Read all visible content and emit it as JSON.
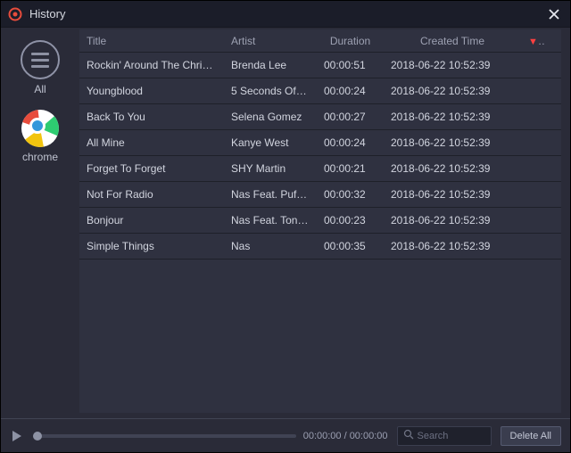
{
  "window": {
    "title": "History"
  },
  "sidebar": {
    "items": [
      {
        "label": "All"
      },
      {
        "label": "chrome"
      }
    ]
  },
  "table": {
    "columns": {
      "title": "Title",
      "artist": "Artist",
      "duration": "Duration",
      "created": "Created Time"
    },
    "rows": [
      {
        "title": "Rockin' Around The Christ…",
        "artist": "Brenda Lee",
        "duration": "00:00:51",
        "created": "2018-06-22 10:52:39"
      },
      {
        "title": "Youngblood",
        "artist": "5 Seconds Of …",
        "duration": "00:00:24",
        "created": "2018-06-22 10:52:39"
      },
      {
        "title": "Back To You",
        "artist": "Selena Gomez",
        "duration": "00:00:27",
        "created": "2018-06-22 10:52:39"
      },
      {
        "title": "All Mine",
        "artist": "Kanye West",
        "duration": "00:00:24",
        "created": "2018-06-22 10:52:39"
      },
      {
        "title": "Forget To Forget",
        "artist": "SHY Martin",
        "duration": "00:00:21",
        "created": "2018-06-22 10:52:39"
      },
      {
        "title": "Not For Radio",
        "artist": "Nas Feat. Puff …",
        "duration": "00:00:32",
        "created": "2018-06-22 10:52:39"
      },
      {
        "title": "Bonjour",
        "artist": "Nas Feat. Tony…",
        "duration": "00:00:23",
        "created": "2018-06-22 10:52:39"
      },
      {
        "title": "Simple Things",
        "artist": "Nas",
        "duration": "00:00:35",
        "created": "2018-06-22 10:52:39"
      }
    ]
  },
  "player": {
    "time_display": "00:00:00 / 00:00:00"
  },
  "search": {
    "placeholder": "Search"
  },
  "actions": {
    "delete_all": "Delete All"
  }
}
